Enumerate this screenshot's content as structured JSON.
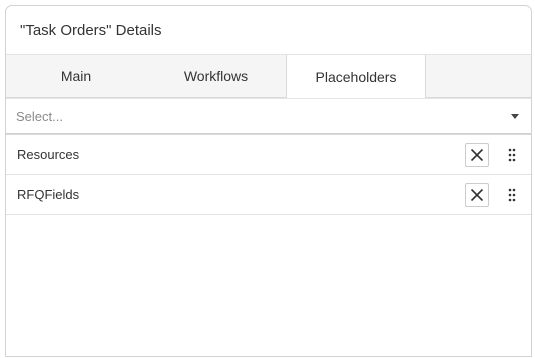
{
  "header": {
    "title": "\"Task Orders\" Details"
  },
  "tabs": [
    {
      "label": "Main"
    },
    {
      "label": "Workflows"
    },
    {
      "label": "Placeholders"
    }
  ],
  "active_tab": "Placeholders",
  "select": {
    "placeholder": "Select..."
  },
  "placeholders": [
    {
      "label": "Resources"
    },
    {
      "label": "RFQFields"
    }
  ],
  "icons": {
    "remove": "close-icon",
    "drag": "drag-handle-icon",
    "dropdown": "chevron-down-icon"
  }
}
